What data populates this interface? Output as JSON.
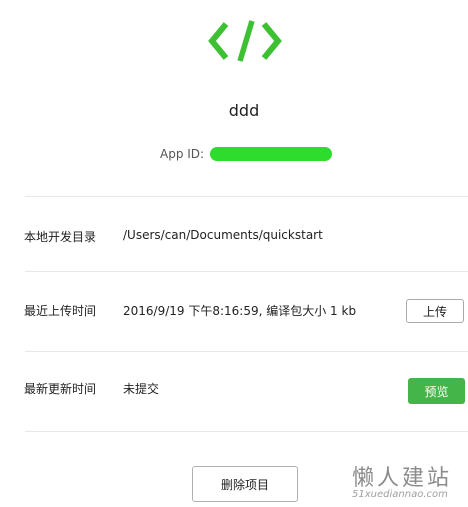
{
  "app": {
    "name": "ddd",
    "appid_label": "App ID:",
    "icon": "code-brackets-icon"
  },
  "rows": {
    "local_dir": {
      "label": "本地开发目录",
      "value": "/Users/can/Documents/quickstart"
    },
    "last_upload": {
      "label": "最近上传时间",
      "value": "2016/9/19 下午8:16:59, 编译包大小 1 kb",
      "button": "上传"
    },
    "last_update": {
      "label": "最新更新时间",
      "value": "未提交",
      "button": "预览"
    }
  },
  "actions": {
    "delete": "删除项目"
  },
  "watermark": {
    "title": "懒人建站",
    "url": "51xuediannao.com"
  },
  "colors": {
    "brand_green": "#3ec033",
    "mask_green": "#2edc2e",
    "primary_button": "#44b549"
  }
}
